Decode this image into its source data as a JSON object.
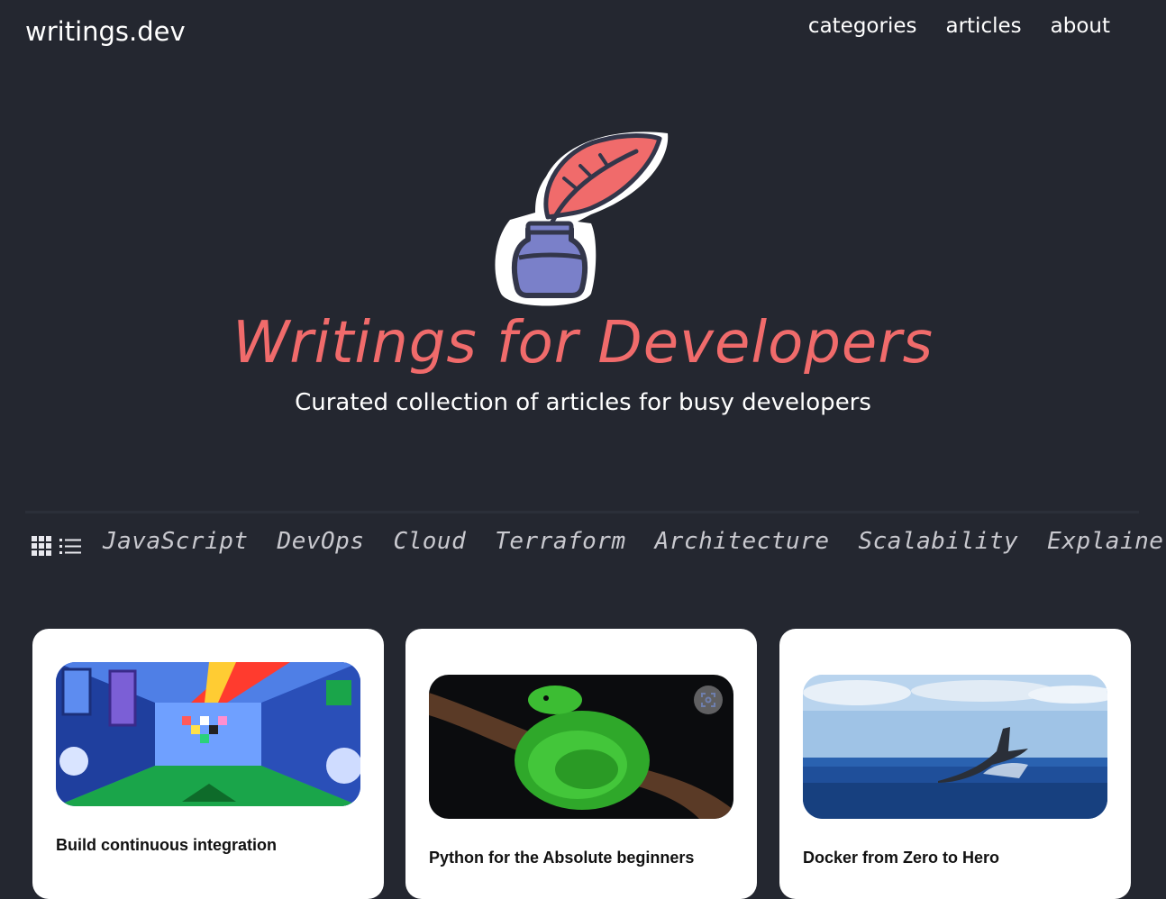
{
  "site": {
    "brand": "writings.dev"
  },
  "nav": {
    "items": [
      "categories",
      "articles",
      "about"
    ]
  },
  "hero": {
    "title": "Writings for Developers",
    "subtitle": "Curated collection of articles for busy developers"
  },
  "categories": [
    "JavaScript",
    "DevOps",
    "Cloud",
    "Terraform",
    "Architecture",
    "Scalability",
    "Explainers"
  ],
  "view_icons": [
    "grid-icon",
    "list-icon"
  ],
  "articles": [
    {
      "title": "Build continuous integration",
      "image": "abstract-tunnel-illustration"
    },
    {
      "title": "Python for the Absolute beginners",
      "image": "green-python-snake-photo"
    },
    {
      "title": "Docker from Zero to Hero",
      "image": "whale-tail-ocean-photo"
    }
  ],
  "colors": {
    "background": "#242730",
    "accent": "#f06b6b",
    "category_text": "#c9c9cf"
  }
}
